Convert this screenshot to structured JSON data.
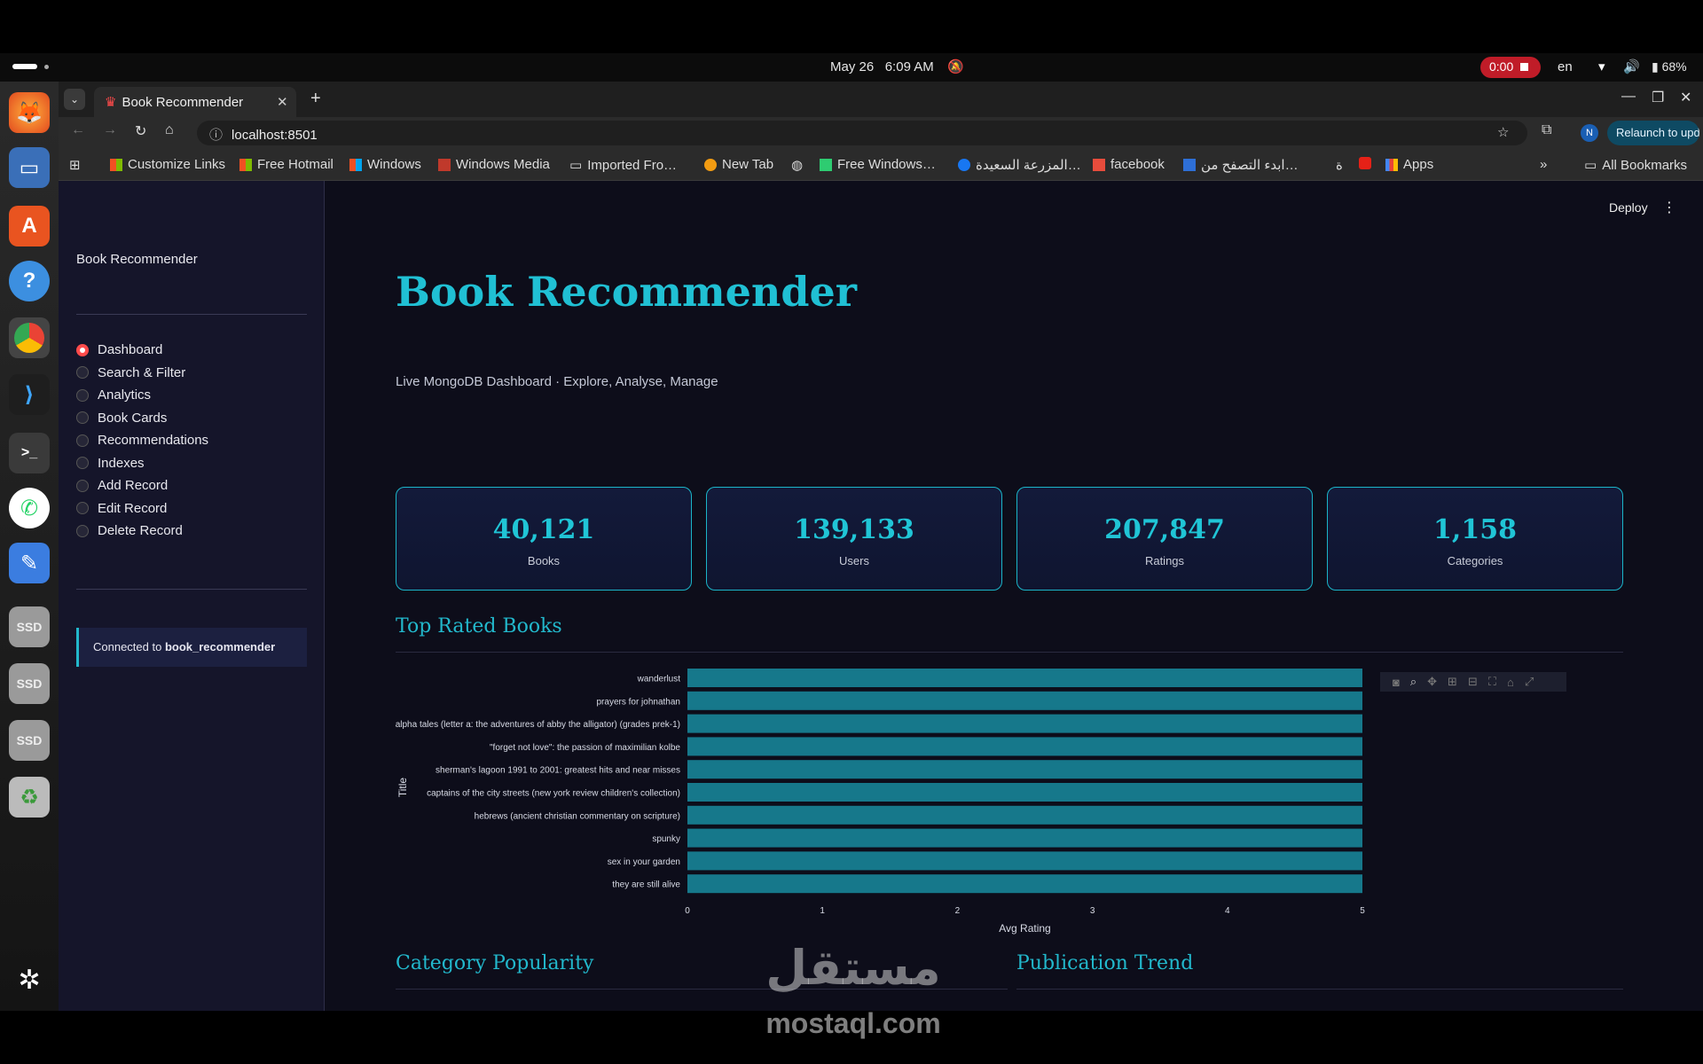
{
  "system": {
    "date": "May 26",
    "time": "6:09 AM",
    "recording": "0:00",
    "lang": "en",
    "battery": "68%"
  },
  "browser": {
    "tab_title": "Book Recommender",
    "url": "localhost:8501",
    "relaunch": "Relaunch to update",
    "profile_initial": "N",
    "bookmarks": [
      "Customize Links",
      "Free Hotmail",
      "Windows",
      "Windows Media",
      "Imported Fro…",
      "New Tab",
      "Free Windows…",
      "المزرعة السعيدة…",
      "facebook",
      "ابدء التصفح من…",
      "ة",
      "Apps"
    ],
    "all_bookmarks": "All Bookmarks"
  },
  "app": {
    "sidebar_title": "Book Recommender",
    "nav": [
      "Dashboard",
      "Search & Filter",
      "Analytics",
      "Book Cards",
      "Recommendations",
      "Indexes",
      "Add Record",
      "Edit Record",
      "Delete Record"
    ],
    "selected": "Dashboard",
    "connected_prefix": "Connected to ",
    "connected_db": "book_recommender",
    "deploy": "Deploy",
    "title": "Book Recommender",
    "subtitle": "Live MongoDB Dashboard · Explore, Analyse, Manage",
    "kpis": [
      {
        "value": "40,121",
        "label": "Books"
      },
      {
        "value": "139,133",
        "label": "Users"
      },
      {
        "value": "207,847",
        "label": "Ratings"
      },
      {
        "value": "1,158",
        "label": "Categories"
      }
    ],
    "section_top": "Top Rated Books",
    "section_cat": "Category Popularity",
    "section_pub": "Publication Trend"
  },
  "chart_data": {
    "type": "bar",
    "orientation": "horizontal",
    "categories": [
      "wanderlust",
      "prayers for johnathan",
      "alpha tales (letter a: the adventures of abby the alligator) (grades prek-1)",
      "\"forget not love\": the passion of maximilian kolbe",
      "sherman's lagoon 1991 to 2001: greatest hits and near misses",
      "captains of the city streets (new york review children's collection)",
      "hebrews (ancient christian commentary on scripture)",
      "spunky",
      "sex in your garden",
      "they are still alive"
    ],
    "values": [
      5,
      5,
      5,
      5,
      5,
      5,
      5,
      5,
      5,
      5
    ],
    "xlabel": "Avg Rating",
    "ylabel": "Title",
    "xlim": [
      0,
      5
    ],
    "xticks": [
      "0",
      "1",
      "2",
      "3",
      "4",
      "5"
    ],
    "bar_color": "#16788b"
  },
  "watermark": {
    "text": "mostaql.com",
    "logo": "مستقل"
  }
}
